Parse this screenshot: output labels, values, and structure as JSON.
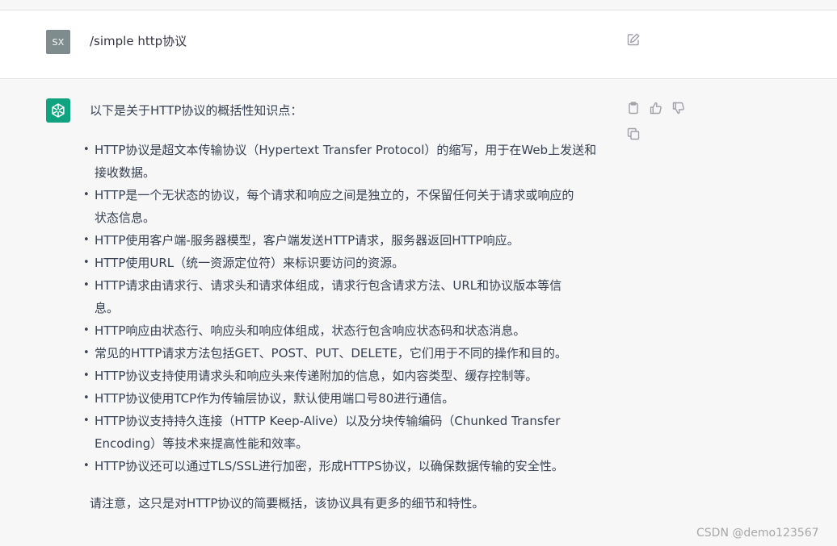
{
  "user_message": {
    "avatar_initials": "SX",
    "text": "/simple http协议",
    "edit_icon": "edit-icon"
  },
  "assistant_message": {
    "avatar_icon": "openai-logo-icon",
    "intro": "以下是关于HTTP协议的概括性知识点：",
    "bullets": [
      [
        "HTTP协议是超文本传输协议（Hypertext Transfer Protocol）的缩写，用于在Web上发送和",
        "接收数据。"
      ],
      [
        "HTTP是一个无状态的协议，每个请求和响应之间是独立的，不保留任何关于请求或响应的",
        "状态信息。"
      ],
      [
        "HTTP使用客户端-服务器模型，客户端发送HTTP请求，服务器返回HTTP响应。"
      ],
      [
        "HTTP使用URL（统一资源定位符）来标识要访问的资源。"
      ],
      [
        "HTTP请求由请求行、请求头和请求体组成，请求行包含请求方法、URL和协议版本等信",
        "息。"
      ],
      [
        "HTTP响应由状态行、响应头和响应体组成，状态行包含响应状态码和状态消息。"
      ],
      [
        "常见的HTTP请求方法包括GET、POST、PUT、DELETE，它们用于不同的操作和目的。"
      ],
      [
        "HTTP协议支持使用请求头和响应头来传递附加的信息，如内容类型、缓存控制等。"
      ],
      [
        "HTTP协议使用TCP作为传输层协议，默认使用端口号80进行通信。"
      ],
      [
        "HTTP协议支持持久连接（HTTP Keep-Alive）以及分块传输编码（Chunked Transfer",
        "Encoding）等技术来提高性能和效率。"
      ],
      [
        "HTTP协议还可以通过TLS/SSL进行加密，形成HTTPS协议，以确保数据传输的安全性。"
      ]
    ],
    "note": "请注意，这只是对HTTP协议的简要概括，该协议具有更多的细节和特性。",
    "action_icons": [
      "clipboard-icon",
      "thumbs-up-icon",
      "thumbs-down-icon",
      "copy-icon"
    ]
  },
  "watermark": "CSDN @demo123567",
  "colors": {
    "bot_avatar": "#10a37f",
    "user_avatar": "#7f8c8d",
    "assistant_bg": "#f7f7f8",
    "user_bg": "#ffffff",
    "text": "#374151"
  }
}
